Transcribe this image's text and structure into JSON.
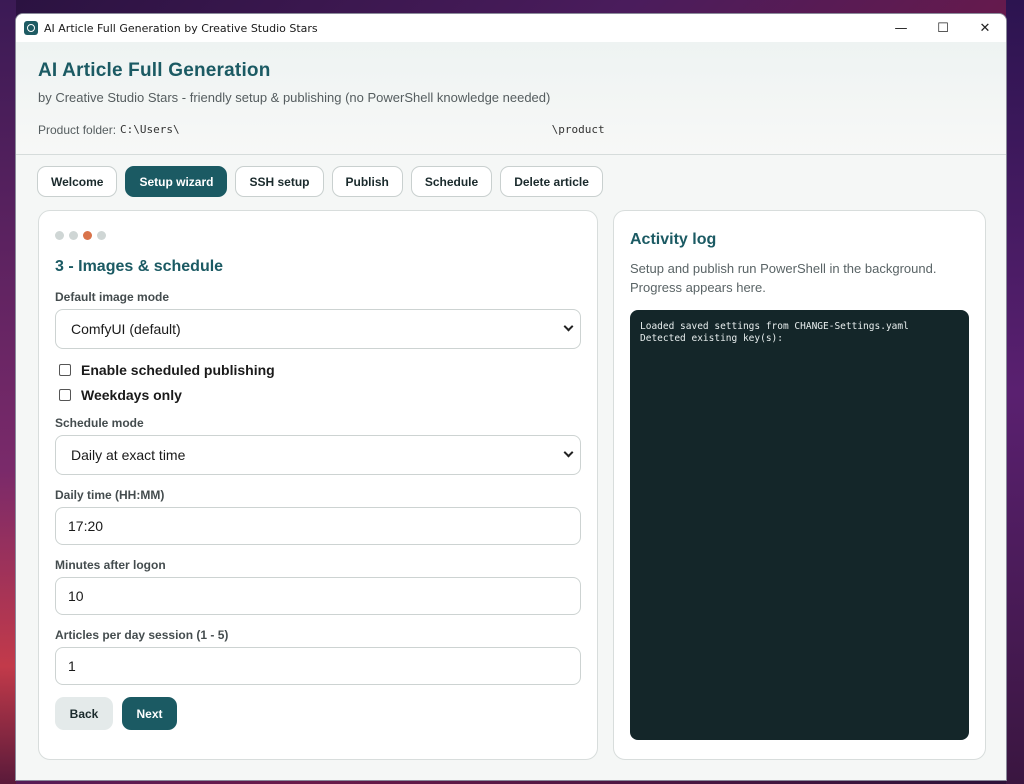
{
  "window": {
    "title": "AI Article Full Generation by Creative Studio Stars",
    "controls": {
      "minimize": "—",
      "maximize": "☐",
      "close": "✕"
    }
  },
  "header": {
    "title": "AI Article Full Generation",
    "subtitle": "by Creative Studio Stars - friendly setup & publishing (no PowerShell knowledge needed)",
    "folder_label": "Product folder:",
    "folder_path_start": "C:\\Users\\",
    "folder_path_end": "\\product"
  },
  "tabs": [
    {
      "label": "Welcome",
      "active": false
    },
    {
      "label": "Setup wizard",
      "active": true
    },
    {
      "label": "SSH setup",
      "active": false
    },
    {
      "label": "Publish",
      "active": false
    },
    {
      "label": "Schedule",
      "active": false
    },
    {
      "label": "Delete article",
      "active": false
    }
  ],
  "wizard": {
    "steps_total": 4,
    "current_step": 3,
    "step_title": "3 - Images & schedule",
    "image_mode": {
      "label": "Default image mode",
      "value": "ComfyUI (default)"
    },
    "enable_scheduled": {
      "label": "Enable scheduled publishing",
      "checked": false
    },
    "weekdays_only": {
      "label": "Weekdays only",
      "checked": false
    },
    "schedule_mode": {
      "label": "Schedule mode",
      "value": "Daily at exact time"
    },
    "daily_time": {
      "label": "Daily time (HH:MM)",
      "value": "17:20"
    },
    "minutes_after_logon": {
      "label": "Minutes after logon",
      "value": "10"
    },
    "articles_per_day": {
      "label": "Articles per day session (1 - 5)",
      "value": "1"
    },
    "back_label": "Back",
    "next_label": "Next"
  },
  "activity_log": {
    "title": "Activity log",
    "description": "Setup and publish run PowerShell in the background. Progress appears here.",
    "lines": [
      "Loaded saved settings from CHANGE-Settings.yaml",
      "Detected existing key(s):"
    ]
  },
  "colors": {
    "accent": "#1b5a63",
    "step_active": "#d9734a",
    "log_background": "#142629"
  }
}
